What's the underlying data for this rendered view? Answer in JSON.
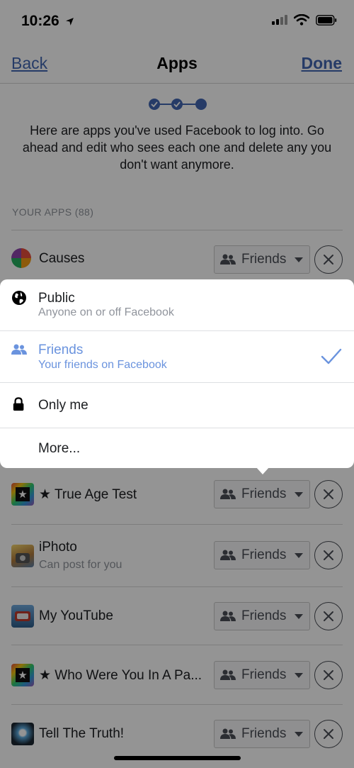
{
  "status_bar": {
    "time": "10:26"
  },
  "nav": {
    "back": "Back",
    "title": "Apps",
    "done": "Done"
  },
  "intro": "Here are apps you've used Facebook to log into. Go ahead and edit who sees each one and delete any you don't want anymore.",
  "section_label": "YOUR APPS (88)",
  "apps": [
    {
      "name": "Causes",
      "subtitle": "",
      "audience": "Friends",
      "icon": "causes-icon"
    },
    {
      "name": "★ True Age Test",
      "subtitle": "",
      "audience": "Friends",
      "icon": "star-app-icon"
    },
    {
      "name": "iPhoto",
      "subtitle": "Can post for you",
      "audience": "Friends",
      "icon": "iphoto-icon"
    },
    {
      "name": "My YouTube",
      "subtitle": "",
      "audience": "Friends",
      "icon": "youtube-app-icon"
    },
    {
      "name": "★ Who Were You In A Pa...",
      "subtitle": "",
      "audience": "Friends",
      "icon": "star-app-icon"
    },
    {
      "name": "Tell The Truth!",
      "subtitle": "",
      "audience": "Friends",
      "icon": "truth-app-icon"
    }
  ],
  "audience_menu": {
    "options": [
      {
        "title": "Public",
        "desc": "Anyone on or off Facebook",
        "icon": "globe-icon",
        "selected": false
      },
      {
        "title": "Friends",
        "desc": "Your friends on Facebook",
        "icon": "friends-icon",
        "selected": true
      },
      {
        "title": "Only me",
        "desc": "",
        "icon": "lock-icon",
        "selected": false
      },
      {
        "title": "More...",
        "desc": "",
        "icon": "",
        "selected": false
      }
    ]
  },
  "colors": {
    "link": "#4267b2",
    "selected": "#6a93de",
    "overlay": "rgba(0,0,0,0.42)"
  }
}
